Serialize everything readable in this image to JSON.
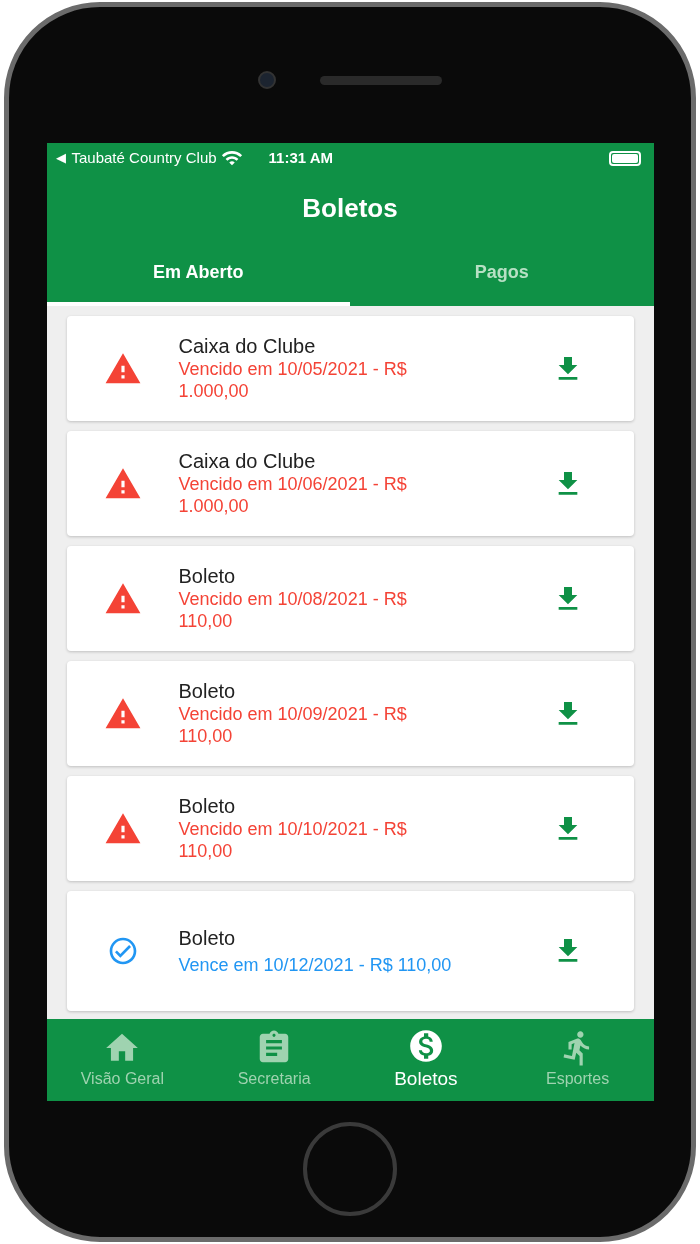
{
  "status_bar": {
    "back_arrow": "◀",
    "carrier": "Taubaté Country Club",
    "time": "11:31 AM"
  },
  "header": {
    "title": "Boletos"
  },
  "tabs": [
    {
      "label": "Em Aberto",
      "selected": true
    },
    {
      "label": "Pagos",
      "selected": false
    }
  ],
  "boletos": [
    {
      "kind": "overdue",
      "title": "Caixa do Clube",
      "detail": "Vencido em 10/05/2021 - R$ 1.000,00"
    },
    {
      "kind": "overdue",
      "title": "Caixa do Clube",
      "detail": "Vencido em 10/06/2021 - R$ 1.000,00"
    },
    {
      "kind": "overdue",
      "title": "Boleto",
      "detail": "Vencido em 10/08/2021 - R$ 110,00"
    },
    {
      "kind": "overdue",
      "title": "Boleto",
      "detail": "Vencido em 10/09/2021 - R$ 110,00"
    },
    {
      "kind": "overdue",
      "title": "Boleto",
      "detail": "Vencido em 10/10/2021 - R$ 110,00"
    },
    {
      "kind": "due",
      "title": "Boleto",
      "detail": "Vence em 10/12/2021 - R$ 110,00"
    }
  ],
  "bottom_nav": [
    {
      "label": "Visão Geral",
      "selected": false
    },
    {
      "label": "Secretaria",
      "selected": false
    },
    {
      "label": "Boletos",
      "selected": true
    },
    {
      "label": "Esportes",
      "selected": false
    }
  ]
}
